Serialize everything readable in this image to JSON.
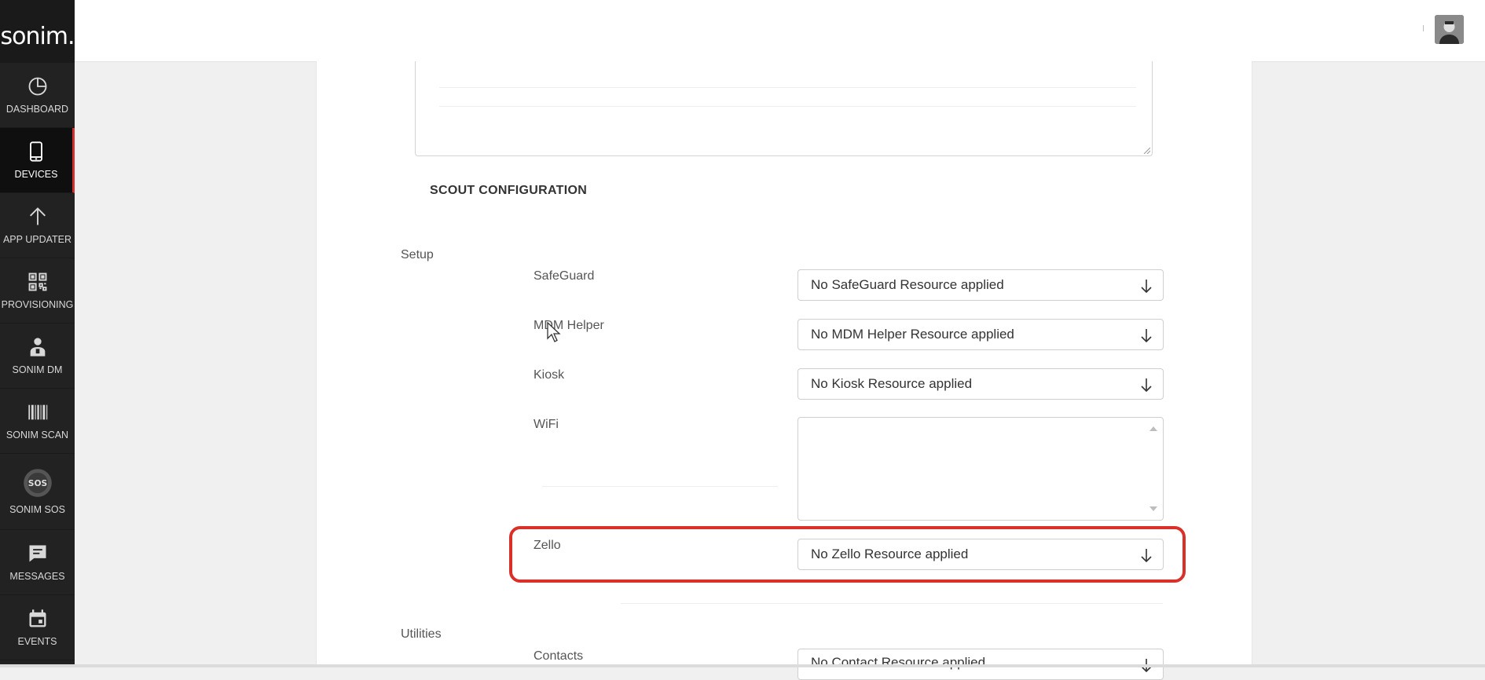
{
  "app": {
    "logo_text": "sonim."
  },
  "sidebar": {
    "items": [
      {
        "label": "DASHBOARD",
        "icon": "pie-chart-icon",
        "active": false
      },
      {
        "label": "DEVICES",
        "icon": "mobile-device-icon",
        "active": true
      },
      {
        "label": "APP UPDATER",
        "icon": "arrow-up-icon",
        "active": false
      },
      {
        "label": "PROVISIONING",
        "icon": "qr-code-icon",
        "active": false
      },
      {
        "label": "SONIM DM",
        "icon": "user-manager-icon",
        "active": false
      },
      {
        "label": "SONIM SCAN",
        "icon": "barcode-icon",
        "active": false
      },
      {
        "label": "SONIM SOS",
        "icon": "sos-icon",
        "active": false,
        "badge": "SOS"
      },
      {
        "label": "MESSAGES",
        "icon": "chat-bubble-icon",
        "active": false
      },
      {
        "label": "EVENTS",
        "icon": "calendar-icon",
        "active": false
      }
    ]
  },
  "main": {
    "section_title": "SCOUT CONFIGURATION",
    "setup": {
      "label": "Setup",
      "fields": [
        {
          "label": "SafeGuard",
          "value": "No SafeGuard Resource applied"
        },
        {
          "label": "MDM Helper",
          "value": "No MDM Helper Resource applied"
        },
        {
          "label": "Kiosk",
          "value": "No Kiosk Resource applied"
        },
        {
          "label": "WiFi",
          "value": ""
        },
        {
          "label": "Zello",
          "value": "No Zello Resource applied"
        }
      ]
    },
    "utilities": {
      "label": "Utilities",
      "fields": [
        {
          "label": "Contacts",
          "value": "No Contact Resource applied"
        }
      ]
    }
  },
  "colors": {
    "sidebar_bg": "#222222",
    "active_accent": "#d32f2f",
    "highlight": "#d9302a"
  }
}
